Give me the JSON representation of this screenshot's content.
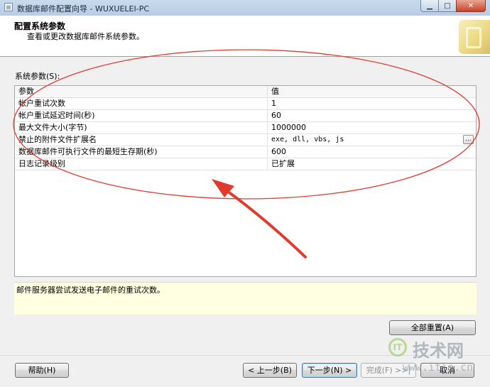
{
  "window": {
    "title": "数据库邮件配置向导 - WUXUELEI-PC",
    "minimize_glyph": "▁",
    "maximize_glyph": "□",
    "close_glyph": "✕"
  },
  "header": {
    "heading": "配置系统参数",
    "subheading": "查看或更改数据库邮件系统参数。"
  },
  "section_label": "系统参数(S):",
  "grid": {
    "columns": [
      "参数",
      "值"
    ],
    "rows": [
      {
        "param": "帐户重试次数",
        "value": "1"
      },
      {
        "param": "帐户重试延迟时间(秒)",
        "value": "60"
      },
      {
        "param": "最大文件大小(字节)",
        "value": "1000000"
      },
      {
        "param": "禁止的附件文件扩展名",
        "value": "exe, dll, vbs, js",
        "has_button": true
      },
      {
        "param": "数据库邮件可执行文件的最短生存期(秒)",
        "value": "600"
      },
      {
        "param": "日志记录级别",
        "value": "已扩展"
      }
    ],
    "ellipsis_label": "..."
  },
  "description": "邮件服务器尝试发送电子邮件的重试次数。",
  "buttons": {
    "reset_all": "全部重置(A)",
    "help": "帮助(H)",
    "back": "< 上一步(B)",
    "next": "下一步(N) >",
    "finish": "完成(F) >>|",
    "cancel": "取消"
  },
  "watermark": {
    "badge": "IT",
    "brand": "技术网",
    "url": "www.itjs.cn"
  },
  "colors": {
    "annotation_red": "#e23b2e",
    "description_bg": "#ffffe1",
    "titlebar": "#c3d6ec",
    "watermark_green": "#8bc34a"
  }
}
